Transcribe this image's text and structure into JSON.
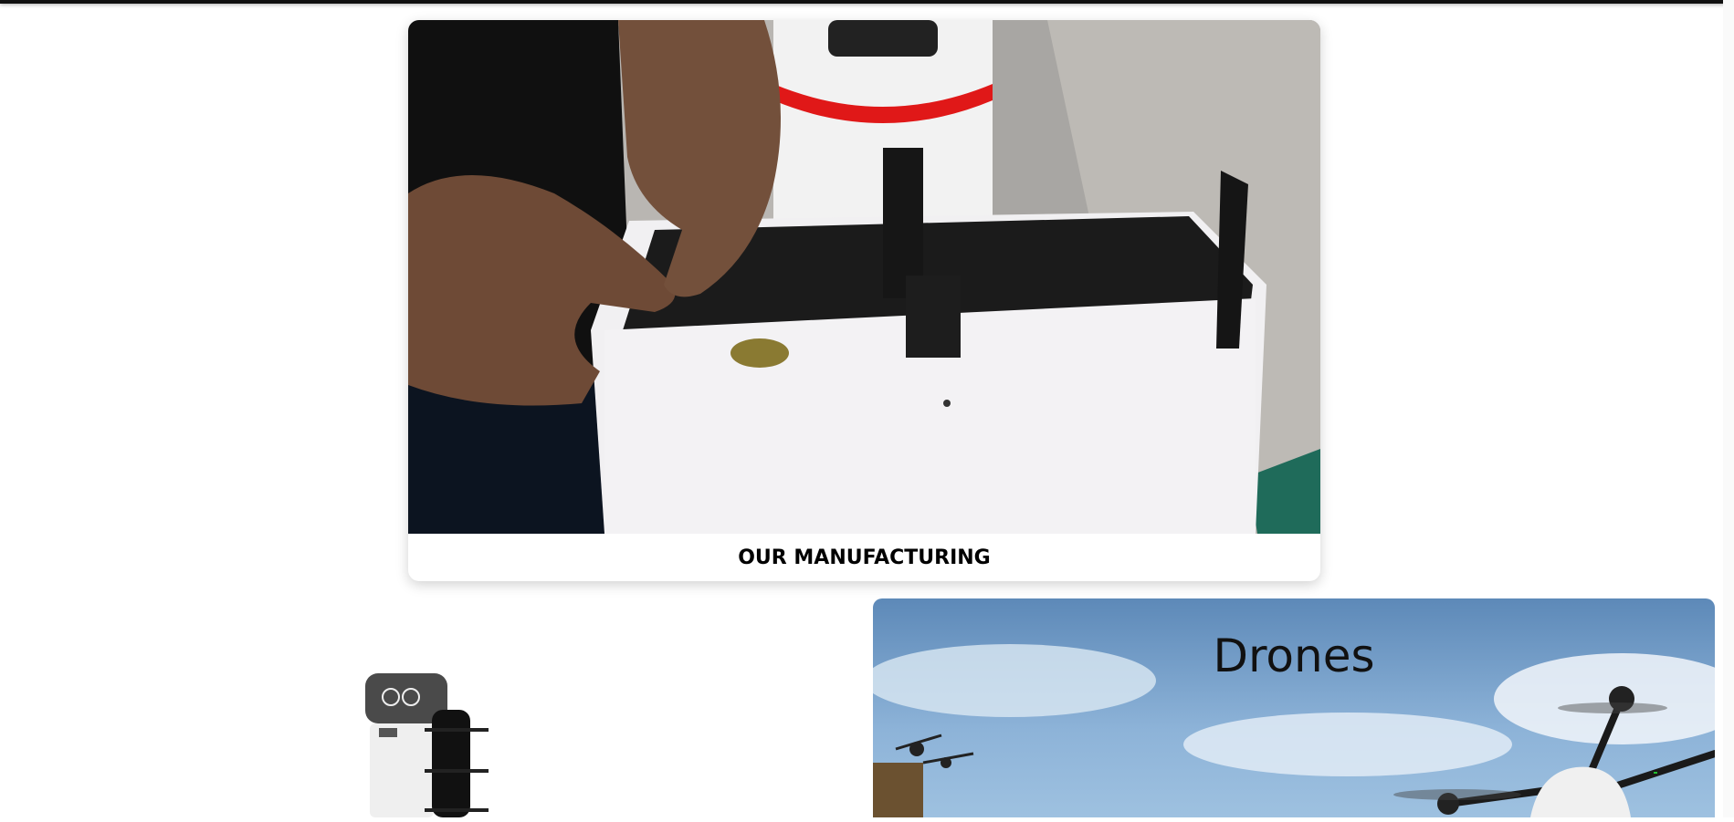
{
  "manufacturing": {
    "caption": "OUR MANUFACTURING"
  },
  "drones": {
    "title": "Drones"
  },
  "icons": {
    "robot": "service-robot-icon"
  }
}
